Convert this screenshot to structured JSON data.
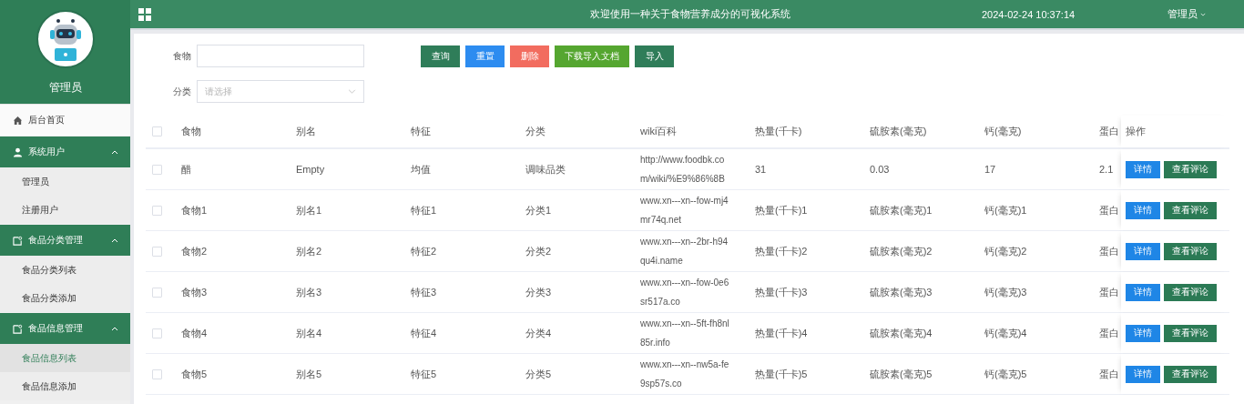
{
  "sidebar": {
    "user": "管理员",
    "menu": [
      {
        "kind": "link",
        "label": "后台首页",
        "selected": false
      },
      {
        "kind": "group",
        "label": "系统用户",
        "expanded": true,
        "children": [
          {
            "label": "管理员",
            "selected": false
          },
          {
            "label": "注册用户",
            "selected": false
          }
        ]
      },
      {
        "kind": "group",
        "label": "食品分类管理",
        "expanded": true,
        "children": [
          {
            "label": "食品分类列表",
            "selected": false
          },
          {
            "label": "食品分类添加",
            "selected": false
          }
        ]
      },
      {
        "kind": "group",
        "label": "食品信息管理",
        "expanded": true,
        "children": [
          {
            "label": "食品信息列表",
            "selected": true
          },
          {
            "label": "食品信息添加",
            "selected": false
          }
        ]
      }
    ]
  },
  "topbar": {
    "title": "欢迎使用一种关于食物营养成分的可视化系统",
    "datetime": "2024-02-24 10:37:14",
    "user": "管理员"
  },
  "filters": [
    {
      "kind": "text",
      "label": "食物"
    },
    {
      "kind": "select",
      "label": "分类",
      "placeholder": "请选择"
    }
  ],
  "buttons": [
    {
      "label": "查询",
      "color": "#2f7d59"
    },
    {
      "label": "重置",
      "color": "#2d8cf0"
    },
    {
      "label": "删除",
      "color": "#f26c5f"
    },
    {
      "label": "下载导入文档",
      "color": "#55a630"
    },
    {
      "label": "导入",
      "color": "#2f7d59"
    }
  ],
  "table": {
    "all_checked": false,
    "columns": [
      "食物",
      "别名",
      "特征",
      "分类",
      "wiki百科",
      "热量(千卡)",
      "硫胺素(毫克)",
      "钙(毫克)",
      "蛋白"
    ],
    "action_column": "操作",
    "rows": [
      {
        "checked": false,
        "cells": [
          "醋",
          "Empty",
          "均值",
          "调味品类",
          "http://www.foodbk.com/wiki/%E9%86%8B",
          "31",
          "0.03",
          "17",
          "2.1"
        ],
        "actions": [
          "详情",
          "查看评论"
        ]
      },
      {
        "checked": false,
        "cells": [
          "食物1",
          "别名1",
          "特征1",
          "分类1",
          "www.xn---xn--fow-mj4mr74q.net",
          "热量(千卡)1",
          "硫胺素(毫克)1",
          "钙(毫克)1",
          "蛋白"
        ],
        "actions": [
          "详情",
          "查看评论"
        ]
      },
      {
        "checked": false,
        "cells": [
          "食物2",
          "别名2",
          "特征2",
          "分类2",
          "www.xn---xn--2br-h94qu4i.name",
          "热量(千卡)2",
          "硫胺素(毫克)2",
          "钙(毫克)2",
          "蛋白"
        ],
        "actions": [
          "详情",
          "查看评论"
        ]
      },
      {
        "checked": false,
        "cells": [
          "食物3",
          "别名3",
          "特征3",
          "分类3",
          "www.xn---xn--fow-0e6sr517a.co",
          "热量(千卡)3",
          "硫胺素(毫克)3",
          "钙(毫克)3",
          "蛋白"
        ],
        "actions": [
          "详情",
          "查看评论"
        ]
      },
      {
        "checked": false,
        "cells": [
          "食物4",
          "别名4",
          "特征4",
          "分类4",
          "www.xn---xn--5ft-fh8nl85r.info",
          "热量(千卡)4",
          "硫胺素(毫克)4",
          "钙(毫克)4",
          "蛋白"
        ],
        "actions": [
          "详情",
          "查看评论"
        ]
      },
      {
        "checked": false,
        "cells": [
          "食物5",
          "别名5",
          "特征5",
          "分类5",
          "www.xn---xn--nw5a-fe9sp57s.co",
          "热量(千卡)5",
          "硫胺素(毫克)5",
          "钙(毫克)5",
          "蛋白"
        ],
        "actions": [
          "详情",
          "查看评论"
        ]
      }
    ]
  }
}
